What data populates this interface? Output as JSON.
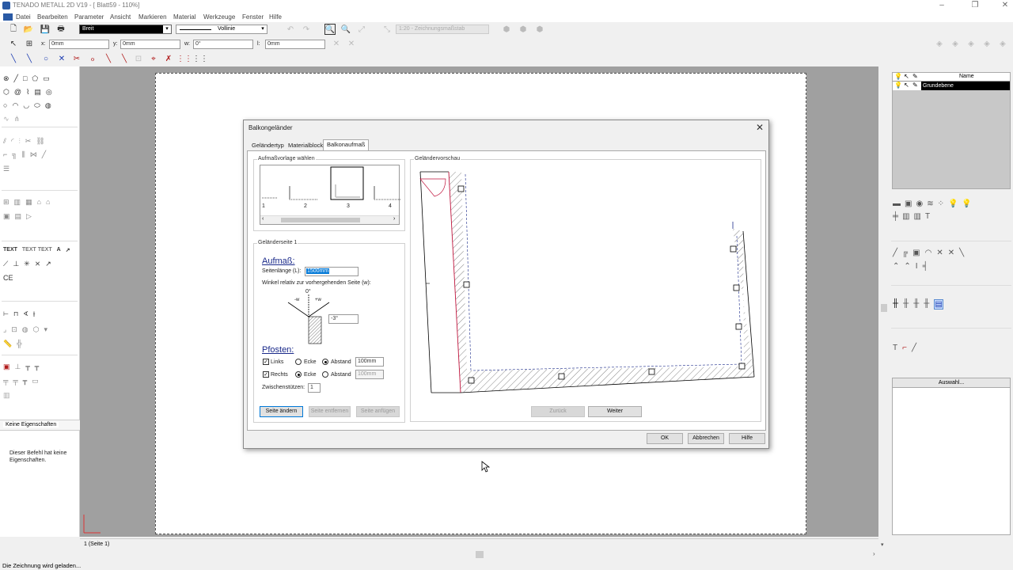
{
  "window": {
    "title": "TENADO METALL 2D V19 - [ Blatt59 - 110%]"
  },
  "menu": [
    "Datei",
    "Bearbeiten",
    "Parameter",
    "Ansicht",
    "Markieren",
    "Material",
    "Werkzeuge",
    "Fenster",
    "Hilfe"
  ],
  "toolbar": {
    "layer": "Breit",
    "linetype": "Vollinie",
    "scale": "1:20 - Zeichnungsmaßstab"
  },
  "coords": {
    "x_label": "x:",
    "x": "0mm",
    "y_label": "y:",
    "y": "0mm",
    "w_label": "w:",
    "w": "0°",
    "l_label": "l:",
    "l": "0mm"
  },
  "left": {
    "text_tool": "TEXT",
    "text_tool2": "TEXT TEXT",
    "properties_tab": "Keine Eigenschaften",
    "properties_msg": "Dieser Befehl hat keine Eigenschaften.",
    "page_tab": "1 (Seite 1)"
  },
  "dialog": {
    "title": "Balkongeländer",
    "tabs": [
      "Geländertyp",
      "Materialblock",
      "Balkonaufmaß"
    ],
    "template_group": "Aufmaßvorlage wählen",
    "templates": [
      "1",
      "2",
      "3",
      "4"
    ],
    "side_group": "Geländerseite 1",
    "aufmass_heading": "Aufmaß:",
    "length_label": "Seitenlänge (L):",
    "length_value": "1500mm",
    "angle_label": "Winkel relativ zur vorhergehenden Seite (w):",
    "angle_top": "0°",
    "angle_minus": "-w",
    "angle_plus": "+w",
    "angle_value": "-3°",
    "posts_heading": "Pfosten:",
    "left_label": "Links",
    "right_label": "Rechts",
    "corner_label": "Ecke",
    "distance_label": "Abstand",
    "left_distance": "100mm",
    "right_distance": "100mm",
    "intermediate_label": "Zwischenstützen:",
    "intermediate_value": "1",
    "btn_change": "Seite ändern",
    "btn_remove": "Seite entfernen",
    "btn_add": "Seite anfügen",
    "preview_group": "Geländervorschau",
    "btn_back": "Zurück",
    "btn_next": "Weiter",
    "btn_ok": "OK",
    "btn_cancel": "Abbrechen",
    "btn_help": "Hilfe"
  },
  "right": {
    "col_name": "Name",
    "layer_name": "Grundebene",
    "select_btn": "Auswahl..."
  },
  "status": {
    "message": "Die Zeichnung wird geladen..."
  }
}
